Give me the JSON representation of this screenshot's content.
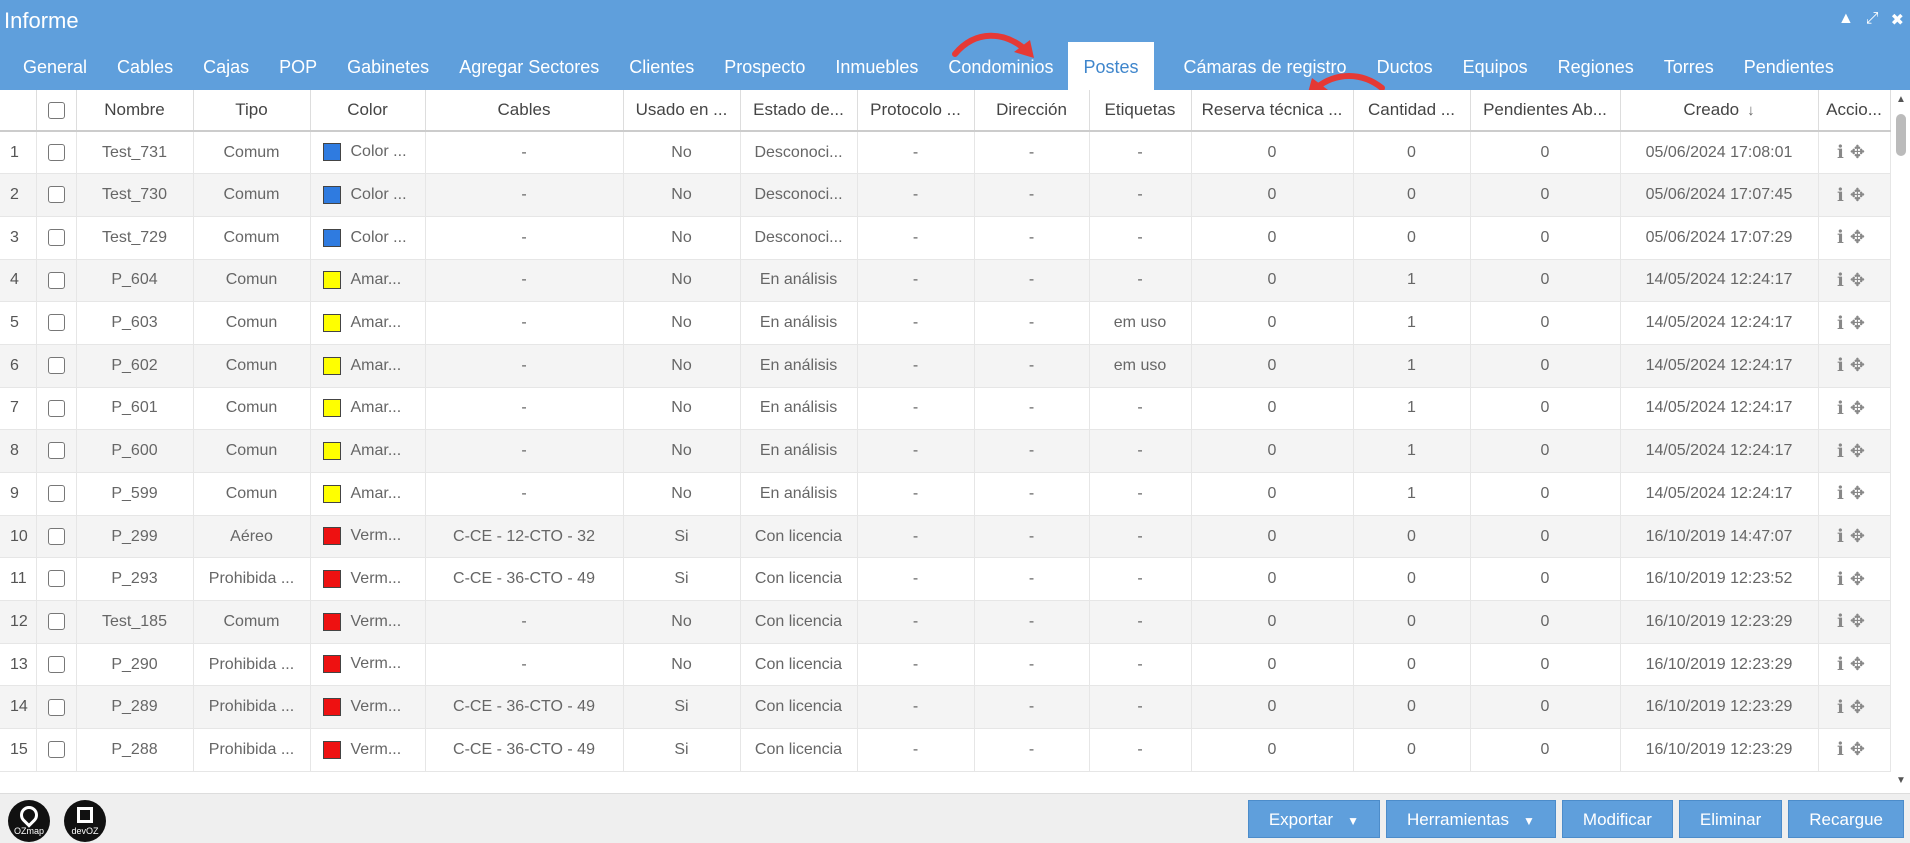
{
  "window": {
    "title": "Informe"
  },
  "tabs": [
    "General",
    "Cables",
    "Cajas",
    "POP",
    "Gabinetes",
    "Agregar Sectores",
    "Clientes",
    "Prospecto",
    "Inmuebles",
    "Condominios",
    "Postes",
    "Cámaras de registro",
    "Ductos",
    "Equipos",
    "Regiones",
    "Torres",
    "Pendientes"
  ],
  "active_tab": "Postes",
  "columns": [
    "Nombre",
    "Tipo",
    "Color",
    "Cables",
    "Usado en ...",
    "Estado de...",
    "Protocolo ...",
    "Dirección",
    "Etiquetas",
    "Reserva técnica ...",
    "Cantidad ...",
    "Pendientes Ab...",
    "Creado",
    "Accio..."
  ],
  "rows": [
    {
      "n": "1",
      "nombre": "Test_731",
      "tipo": "Comum",
      "color": "#2f7be0",
      "color_label": "Color ...",
      "cables": "-",
      "usado": "No",
      "estado": "Desconoci...",
      "protocolo": "-",
      "direccion": "-",
      "etiquetas": "-",
      "reserva": "0",
      "cantidad": "0",
      "pendientes": "0",
      "creado": "05/06/2024 17:08:01"
    },
    {
      "n": "2",
      "nombre": "Test_730",
      "tipo": "Comum",
      "color": "#2f7be0",
      "color_label": "Color ...",
      "cables": "-",
      "usado": "No",
      "estado": "Desconoci...",
      "protocolo": "-",
      "direccion": "-",
      "etiquetas": "-",
      "reserva": "0",
      "cantidad": "0",
      "pendientes": "0",
      "creado": "05/06/2024 17:07:45"
    },
    {
      "n": "3",
      "nombre": "Test_729",
      "tipo": "Comum",
      "color": "#2f7be0",
      "color_label": "Color ...",
      "cables": "-",
      "usado": "No",
      "estado": "Desconoci...",
      "protocolo": "-",
      "direccion": "-",
      "etiquetas": "-",
      "reserva": "0",
      "cantidad": "0",
      "pendientes": "0",
      "creado": "05/06/2024 17:07:29"
    },
    {
      "n": "4",
      "nombre": "P_604",
      "tipo": "Comun",
      "color": "#ffff00",
      "color_label": "Amar...",
      "cables": "-",
      "usado": "No",
      "estado": "En análisis",
      "protocolo": "-",
      "direccion": "-",
      "etiquetas": "-",
      "reserva": "0",
      "cantidad": "1",
      "pendientes": "0",
      "creado": "14/05/2024 12:24:17"
    },
    {
      "n": "5",
      "nombre": "P_603",
      "tipo": "Comun",
      "color": "#ffff00",
      "color_label": "Amar...",
      "cables": "-",
      "usado": "No",
      "estado": "En análisis",
      "protocolo": "-",
      "direccion": "-",
      "etiquetas": "em uso",
      "reserva": "0",
      "cantidad": "1",
      "pendientes": "0",
      "creado": "14/05/2024 12:24:17"
    },
    {
      "n": "6",
      "nombre": "P_602",
      "tipo": "Comun",
      "color": "#ffff00",
      "color_label": "Amar...",
      "cables": "-",
      "usado": "No",
      "estado": "En análisis",
      "protocolo": "-",
      "direccion": "-",
      "etiquetas": "em uso",
      "reserva": "0",
      "cantidad": "1",
      "pendientes": "0",
      "creado": "14/05/2024 12:24:17"
    },
    {
      "n": "7",
      "nombre": "P_601",
      "tipo": "Comun",
      "color": "#ffff00",
      "color_label": "Amar...",
      "cables": "-",
      "usado": "No",
      "estado": "En análisis",
      "protocolo": "-",
      "direccion": "-",
      "etiquetas": "-",
      "reserva": "0",
      "cantidad": "1",
      "pendientes": "0",
      "creado": "14/05/2024 12:24:17"
    },
    {
      "n": "8",
      "nombre": "P_600",
      "tipo": "Comun",
      "color": "#ffff00",
      "color_label": "Amar...",
      "cables": "-",
      "usado": "No",
      "estado": "En análisis",
      "protocolo": "-",
      "direccion": "-",
      "etiquetas": "-",
      "reserva": "0",
      "cantidad": "1",
      "pendientes": "0",
      "creado": "14/05/2024 12:24:17"
    },
    {
      "n": "9",
      "nombre": "P_599",
      "tipo": "Comun",
      "color": "#ffff00",
      "color_label": "Amar...",
      "cables": "-",
      "usado": "No",
      "estado": "En análisis",
      "protocolo": "-",
      "direccion": "-",
      "etiquetas": "-",
      "reserva": "0",
      "cantidad": "1",
      "pendientes": "0",
      "creado": "14/05/2024 12:24:17"
    },
    {
      "n": "10",
      "nombre": "P_299",
      "tipo": "Aéreo",
      "color": "#ee1111",
      "color_label": "Verm...",
      "cables": "C-CE - 12-CTO - 32",
      "usado": "Si",
      "estado": "Con licencia",
      "protocolo": "-",
      "direccion": "-",
      "etiquetas": "-",
      "reserva": "0",
      "cantidad": "0",
      "pendientes": "0",
      "creado": "16/10/2019 14:47:07"
    },
    {
      "n": "11",
      "nombre": "P_293",
      "tipo": "Prohibida ...",
      "color": "#ee1111",
      "color_label": "Verm...",
      "cables": "C-CE - 36-CTO - 49",
      "usado": "Si",
      "estado": "Con licencia",
      "protocolo": "-",
      "direccion": "-",
      "etiquetas": "-",
      "reserva": "0",
      "cantidad": "0",
      "pendientes": "0",
      "creado": "16/10/2019 12:23:52"
    },
    {
      "n": "12",
      "nombre": "Test_185",
      "tipo": "Comum",
      "color": "#ee1111",
      "color_label": "Verm...",
      "cables": "-",
      "usado": "No",
      "estado": "Con licencia",
      "protocolo": "-",
      "direccion": "-",
      "etiquetas": "-",
      "reserva": "0",
      "cantidad": "0",
      "pendientes": "0",
      "creado": "16/10/2019 12:23:29"
    },
    {
      "n": "13",
      "nombre": "P_290",
      "tipo": "Prohibida ...",
      "color": "#ee1111",
      "color_label": "Verm...",
      "cables": "-",
      "usado": "No",
      "estado": "Con licencia",
      "protocolo": "-",
      "direccion": "-",
      "etiquetas": "-",
      "reserva": "0",
      "cantidad": "0",
      "pendientes": "0",
      "creado": "16/10/2019 12:23:29"
    },
    {
      "n": "14",
      "nombre": "P_289",
      "tipo": "Prohibida ...",
      "color": "#ee1111",
      "color_label": "Verm...",
      "cables": "C-CE - 36-CTO - 49",
      "usado": "Si",
      "estado": "Con licencia",
      "protocolo": "-",
      "direccion": "-",
      "etiquetas": "-",
      "reserva": "0",
      "cantidad": "0",
      "pendientes": "0",
      "creado": "16/10/2019 12:23:29"
    },
    {
      "n": "15",
      "nombre": "P_288",
      "tipo": "Prohibida ...",
      "color": "#ee1111",
      "color_label": "Verm...",
      "cables": "C-CE - 36-CTO - 49",
      "usado": "Si",
      "estado": "Con licencia",
      "protocolo": "-",
      "direccion": "-",
      "etiquetas": "-",
      "reserva": "0",
      "cantidad": "0",
      "pendientes": "0",
      "creado": "16/10/2019 12:23:29"
    }
  ],
  "footer": {
    "logo_ozmap": "OZmap",
    "logo_devoz": "devOZ",
    "buttons": [
      "Exportar",
      "Herramientas",
      "Modificar",
      "Eliminar",
      "Recargue"
    ]
  },
  "icons": {
    "info": "info-icon",
    "move": "move-icon",
    "sort": "sort-desc-icon"
  },
  "colors": {
    "primary": "#5f9fdc",
    "annotation_arrow": "#e53935"
  }
}
